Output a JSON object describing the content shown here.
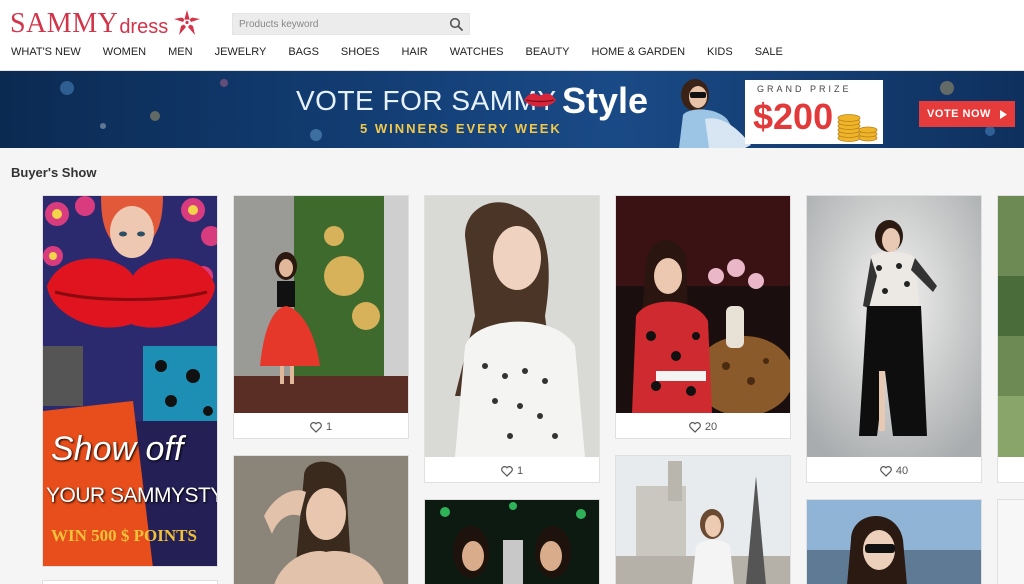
{
  "header": {
    "logo_main": "SAMMY",
    "logo_sub": "dress",
    "search_placeholder": "Products keyword",
    "nav": [
      "WHAT'S NEW",
      "WOMEN",
      "MEN",
      "JEWELRY",
      "BAGS",
      "SHOES",
      "HAIR",
      "WATCHES",
      "BEAUTY",
      "HOME & GARDEN",
      "KIDS",
      "SALE"
    ]
  },
  "banner": {
    "title": "VOTE FOR SAMMY",
    "title_style": "Style",
    "subtitle": "5 WINNERS  EVERY WEEK",
    "prize_label": "GRAND PRIZE",
    "prize_amount": "$200",
    "vote_button": "VOTE NOW"
  },
  "section": {
    "title": "Buyer's Show"
  },
  "promo": {
    "line1": "Show off",
    "line2": "YOUR SAMMYSTYLE",
    "line3": "WIN 500 $ POINTS"
  },
  "cards": [
    {
      "likes": "1"
    },
    {
      "likes": "1"
    },
    {
      "likes": "20"
    },
    {
      "likes": "40"
    }
  ],
  "colors": {
    "brand": "#d2344a",
    "vote": "#e63b3b",
    "banner_bg": "#123d73",
    "accent_yellow": "#f2c84b"
  }
}
